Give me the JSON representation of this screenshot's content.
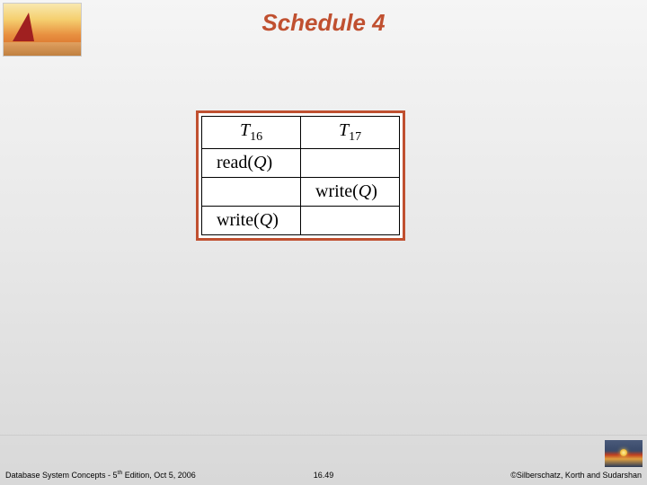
{
  "title": "Schedule 4",
  "table": {
    "headers": {
      "t16_base": "T",
      "t16_sub": "16",
      "t17_base": "T",
      "t17_sub": "17"
    },
    "rows": [
      {
        "left_op": "read",
        "left_var": "Q",
        "right_op": "",
        "right_var": ""
      },
      {
        "left_op": "",
        "left_var": "",
        "right_op": "write",
        "right_var": "Q"
      },
      {
        "left_op": "write",
        "left_var": "Q",
        "right_op": "",
        "right_var": ""
      }
    ]
  },
  "footer": {
    "left_prefix": "Database System Concepts - 5",
    "left_super": "th",
    "left_suffix": " Edition, Oct 5, 2006",
    "center": "16.49",
    "right": "©Silberschatz, Korth and Sudarshan"
  }
}
